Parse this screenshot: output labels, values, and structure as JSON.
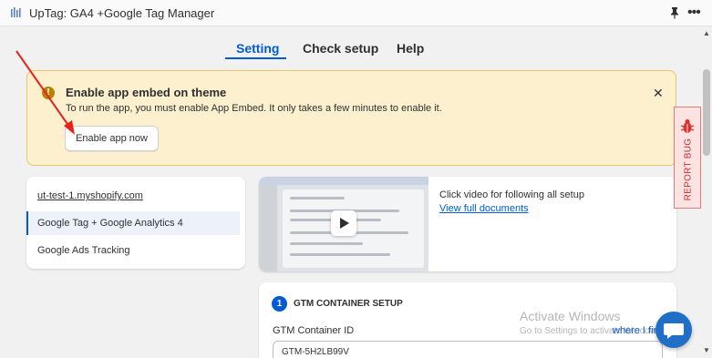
{
  "app": {
    "title": "UpTag: GA4 +Google Tag Manager"
  },
  "tabs": [
    {
      "label": "Setting"
    },
    {
      "label": "Check setup"
    },
    {
      "label": "Help"
    }
  ],
  "banner": {
    "title": "Enable app embed on theme",
    "text": "To run the app, you must enable App Embed. It only takes a few minutes to enable it.",
    "button": "Enable app now",
    "close": "✕"
  },
  "nav": {
    "store_link": "ut-test-1.myshopify.com",
    "items": [
      {
        "label": "Google Tag + Google Analytics 4"
      },
      {
        "label": "Google Ads Tracking"
      }
    ]
  },
  "video": {
    "caption": "Click video for following all setup",
    "link": "View full documents"
  },
  "gtm": {
    "step": "1",
    "title": "GTM CONTAINER SETUP",
    "label": "GTM Container ID",
    "link": "where I find",
    "value": "GTM-5H2LB99V"
  },
  "watermark": {
    "title": "Activate Windows",
    "subtitle": "Go to Settings to activate Windows."
  },
  "report_bug": {
    "label": "REPORT BUG"
  },
  "colors": {
    "accent": "#005bd3",
    "banner_bg": "#fcf0cf",
    "report_red": "#c22b2b"
  }
}
